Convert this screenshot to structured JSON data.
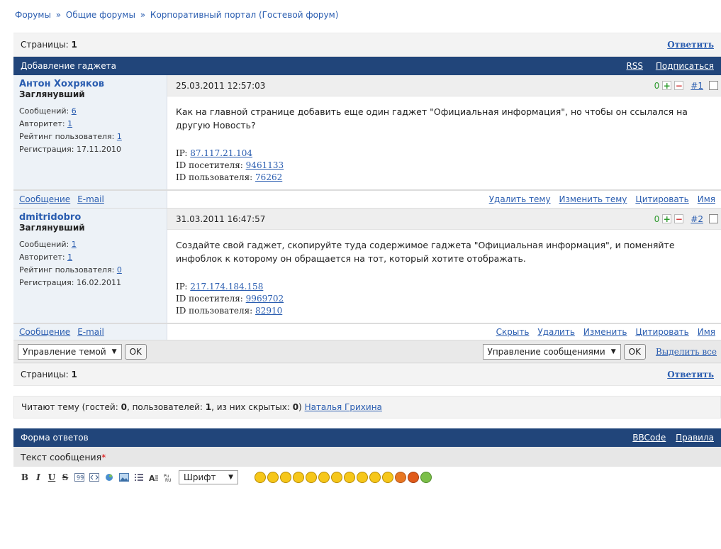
{
  "breadcrumb": [
    "Форумы",
    "Общие форумы",
    "Корпоративный портал (Гостевой форум)"
  ],
  "breadcrumb_sep": "»",
  "pager": {
    "label": "Страницы:",
    "current": "1",
    "reply": "Ответить"
  },
  "topic": {
    "title": "Добавление гаджета",
    "rss": "RSS",
    "subscribe": "Подписаться"
  },
  "posts": [
    {
      "author": "Антон Хохряков",
      "rank": "Заглянувший",
      "messages_label": "Сообщений:",
      "messages": "6",
      "authority_label": "Авторитет:",
      "authority": "1",
      "rating_label": "Рейтинг пользователя:",
      "rating": "1",
      "reg_label": "Регистрация:",
      "reg": "17.11.2010",
      "date": "25.03.2011 12:57:03",
      "score": "0",
      "num": "#1",
      "text": "Как на главной странице добавить еще один гаджет \"Официальная информация\", но чтобы он ссылался на другую Новость?",
      "ip_label": "IP:",
      "ip": "87.117.21.104",
      "visitor_label": "ID посетителя:",
      "visitor": "9461133",
      "user_label": "ID пользователя:",
      "user": "76262",
      "left_actions": [
        "Сообщение",
        "E-mail"
      ],
      "right_actions": [
        "Удалить тему",
        "Изменить тему",
        "Цитировать",
        "Имя"
      ]
    },
    {
      "author": "dmitridobro",
      "rank": "Заглянувший",
      "messages_label": "Сообщений:",
      "messages": "1",
      "authority_label": "Авторитет:",
      "authority": "1",
      "rating_label": "Рейтинг пользователя:",
      "rating": "0",
      "reg_label": "Регистрация:",
      "reg": "16.02.2011",
      "date": "31.03.2011 16:47:57",
      "score": "0",
      "num": "#2",
      "text": "Создайте свой гаджет, скопируйте туда содержимое гаджета \"Официальная информация\", и поменяйте инфоблок к которому он обращается на тот, который хотите отображать.",
      "ip_label": "IP:",
      "ip": "217.174.184.158",
      "visitor_label": "ID посетителя:",
      "visitor": "9969702",
      "user_label": "ID пользователя:",
      "user": "82910",
      "left_actions": [
        "Сообщение",
        "E-mail"
      ],
      "right_actions": [
        "Скрыть",
        "Удалить",
        "Изменить",
        "Цитировать",
        "Имя"
      ]
    }
  ],
  "moderation": {
    "topic_select": "Управление темой",
    "ok": "OK",
    "messages_select": "Управление сообщениями",
    "select_all": "Выделить все"
  },
  "readers": {
    "prefix": "Читают тему (гостей:",
    "guests": "0",
    "users_label": ", пользователей:",
    "users": "1",
    "hidden_label": ", из них скрытых:",
    "hidden": "0",
    "suffix": ")",
    "name": "Наталья Грихина"
  },
  "reply_form": {
    "title": "Форма ответов",
    "bbcode": "BBCode",
    "rules": "Правила",
    "label": "Текст сообщения",
    "required": "*",
    "font_select": "Шрифт"
  },
  "toolbar_icons": [
    "bold-icon",
    "italic-icon",
    "underline-icon",
    "strike-icon",
    "quote-icon",
    "code-icon",
    "link-icon",
    "image-icon",
    "list-icon",
    "font-size-icon",
    "translit-icon"
  ],
  "smileys": [
    "smile",
    "wink",
    "laugh",
    "cool",
    "sad",
    "neutral",
    "frown",
    "angry",
    "crying",
    "dizzy",
    "surprised",
    "question",
    "exclamation",
    "idea"
  ],
  "colors": {
    "header": "#21457a",
    "link": "#2a5db0",
    "author_bg": "#edf2f7",
    "smiley": "#f6c71a"
  }
}
